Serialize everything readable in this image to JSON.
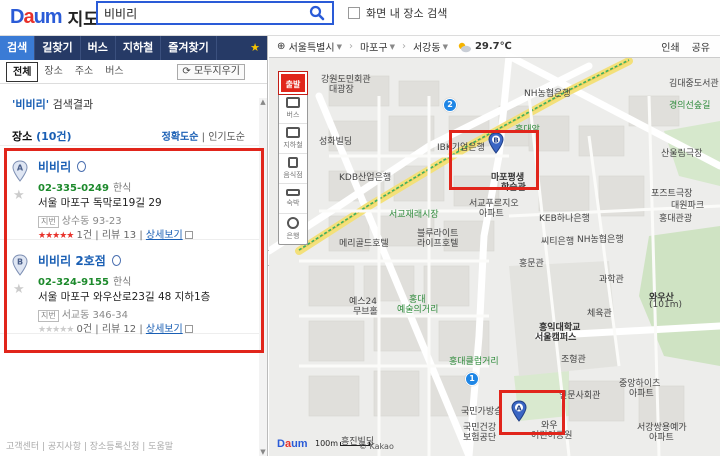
{
  "header": {
    "logo": {
      "d": "D",
      "a": "a",
      "um": "um"
    },
    "service_name": "지도",
    "search_value": "비비리",
    "area_search_label": "화면 내 장소 검색"
  },
  "tabs": {
    "main": [
      "검색",
      "길찾기",
      "버스",
      "지하철",
      "즐겨찾기"
    ],
    "sub": [
      "전체",
      "장소",
      "주소",
      "버스"
    ],
    "unfold": "모두지우기"
  },
  "results": {
    "query": "'비비리'",
    "suffix": " 검색결과",
    "section_label": "장소",
    "count": "(10건)",
    "sort_accuracy": "정확도순",
    "sort_popular": "인기도순",
    "items": [
      {
        "marker": "A",
        "name": "비비리",
        "branch": "",
        "phone": "02-335-0249",
        "category": "한식",
        "address": "서울 마포구 독막로19길 29",
        "jibun_tag": "지번",
        "jibun": "상수동 93-23",
        "rating_stars": "★★★★★",
        "rating_off": "",
        "rating_count": "1건",
        "reviews": "리뷰 13",
        "detail": "상세보기"
      },
      {
        "marker": "B",
        "name": "비비리",
        "branch": "2호점",
        "phone": "02-324-9155",
        "category": "한식",
        "address": "서울 마포구 와우산로23길 48 지하1층",
        "jibun_tag": "지번",
        "jibun": "서교동 346-34",
        "rating_stars": "",
        "rating_off": "★★★★★",
        "rating_count": "0건",
        "reviews": "리뷰 12",
        "detail": "상세보기"
      }
    ]
  },
  "map": {
    "breadcrumb": [
      "서울특별시",
      "마포구",
      "서강동"
    ],
    "temperature": "29.7℃",
    "tools": [
      "인쇄",
      "공유"
    ],
    "toolbar": {
      "top": "출발",
      "buttons": [
        "버스",
        "지하철",
        "음식점",
        "숙박",
        "은행"
      ]
    },
    "labels": [
      "강원도민회관",
      "대광장",
      "성화빌딩",
      "KDB산업은행",
      "IBK기업은행",
      "홍대앞",
      "서교푸르지오",
      "아파트",
      "서교재래시장",
      "KEB하나은행",
      "메리골드호텔",
      "블루라이트",
      "라이프호텔",
      "NH농협은행",
      "씨티은행",
      "홍문관",
      "예스24",
      "무브홀",
      "홍대",
      "예술의거리",
      "홍대클럽거리",
      "국민건강",
      "보험공단",
      "국민가방승",
      "흥진빌딩",
      "와우산",
      "(101m)",
      "홍익대학교",
      "서울캠퍼스",
      "조형관",
      "와우",
      "어린이공원",
      "마포평생",
      "학습관",
      "포즈트극장",
      "대원파크",
      "홍대관광",
      "중앙하이츠",
      "아파트",
      "산울림극장",
      "김대중도서관",
      "경의선숲길",
      "NH농협은행",
      "서강쌍용예가",
      "아파트",
      "인문사회관",
      "과학관",
      "체육관"
    ],
    "pins": {
      "numbered_1": "1",
      "numbered_2": "2",
      "marker_a": "A",
      "marker_b": "B"
    },
    "scale": "100m",
    "copyright": "© Kakao"
  },
  "left_footer": "고객센터  |  공지사항  |  장소등록신청  |  도움말",
  "colors": {
    "brand_blue": "#2a5bd7",
    "nav_dark": "#263a66",
    "active_tab": "#3a7bd5",
    "highlight_red": "#e1251b",
    "link_blue": "#1a5fb4",
    "phone_green": "#1d8a2c"
  }
}
